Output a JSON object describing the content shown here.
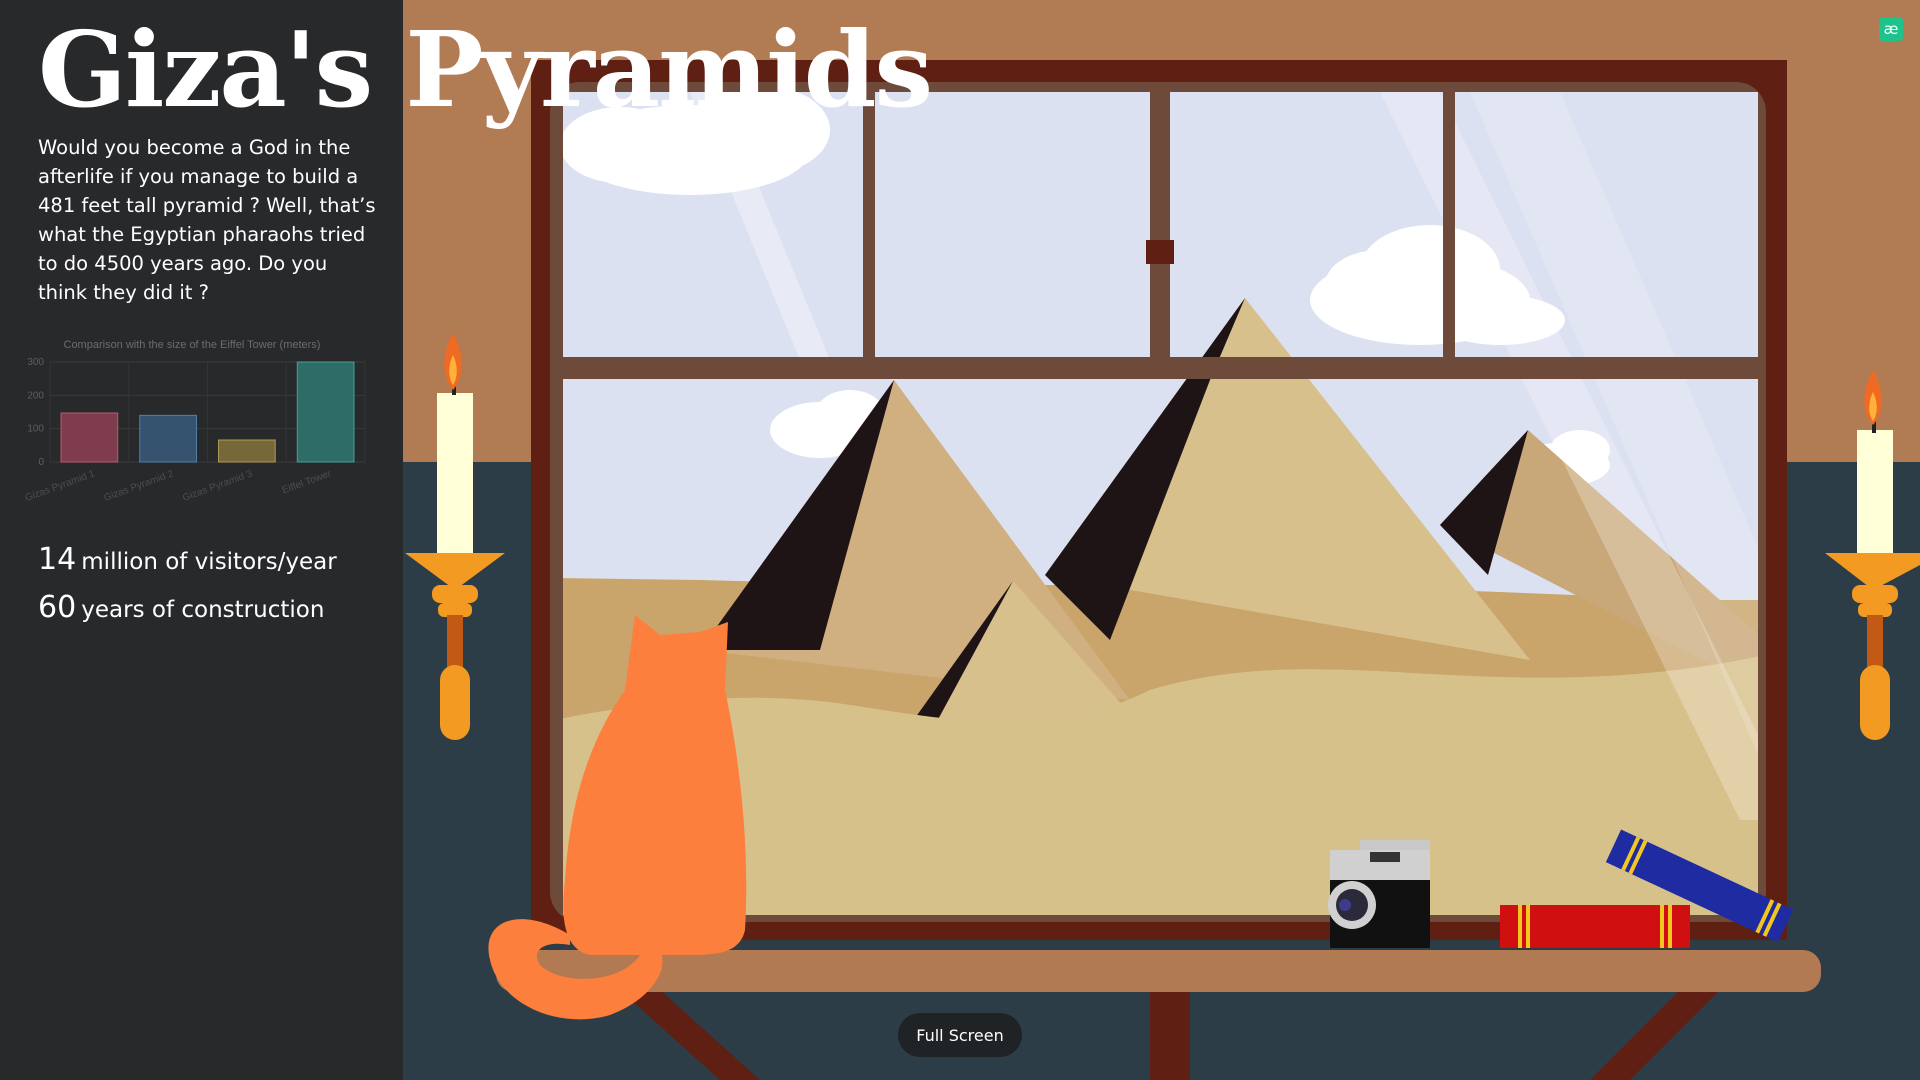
{
  "title": "Giza's Pyramids",
  "intro": "Would you become a God in the afterlife if you manage to build a 481 feet tall pyramid ? Well, that’s what the Egyptian pharaohs tried to do 4500 years ago. Do you think they did it ?",
  "stats": [
    {
      "value": "14",
      "label": "million of visitors/year"
    },
    {
      "value": "60",
      "label": "years of construction"
    }
  ],
  "fullscreen_label": "Full Screen",
  "logo_text": "æ",
  "chart_data": {
    "type": "bar",
    "title": "Comparison with the size of the Eiffel Tower (meters)",
    "categories": [
      "Gizas Pyramid 1",
      "Gizas Pyramid 2",
      "Gizas Pyramid 3",
      "Eiffel Tower"
    ],
    "values": [
      147,
      140,
      66,
      300
    ],
    "ylim": [
      0,
      300
    ],
    "yticks": [
      0,
      100,
      200,
      300
    ],
    "grid": true,
    "colors": [
      "#7e3c4d",
      "#35536f",
      "#77683a",
      "#2e6d67"
    ],
    "stroke_colors": [
      "#b85c72",
      "#4f82aa",
      "#b09a55",
      "#45a096"
    ]
  },
  "colors": {
    "sidebar_bg": "#28292b",
    "wall_top": "#b17b54",
    "wall_bottom": "#2d3d47",
    "frame": "#5f1f12",
    "sky": "#dce1f1",
    "sand": "#d7c18b",
    "cat": "#fd7f3e",
    "shelf": "#b27a53",
    "logo": "#1ec28b"
  }
}
